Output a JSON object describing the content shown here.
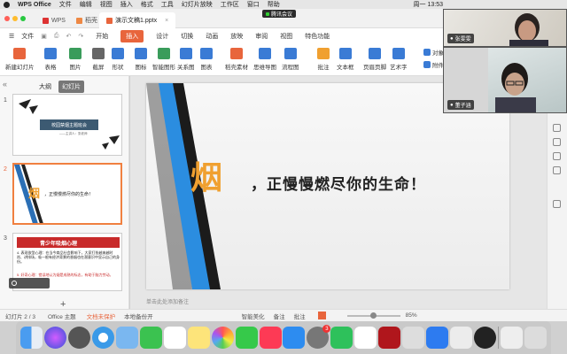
{
  "mac_menu": [
    "WPS Office",
    "文件",
    "编辑",
    "视图",
    "插入",
    "格式",
    "工具",
    "幻灯片放映",
    "工作区",
    "窗口",
    "帮助"
  ],
  "mac_status": {
    "clock": "周一 13:53"
  },
  "meeting_pill": "腾讯会议",
  "tabs": [
    {
      "label": "WPS",
      "active": false
    },
    {
      "label": "稻壳",
      "active": false
    },
    {
      "label": "演示文稿1.pptx",
      "active": true
    }
  ],
  "app_menu": {
    "left": [
      "文件"
    ],
    "tabs": [
      "开始",
      "插入",
      "设计",
      "切换",
      "动画",
      "放映",
      "审阅",
      "视图",
      "特色功能"
    ],
    "active_tab": "插入"
  },
  "ribbon": [
    {
      "label": "新建幻灯片",
      "color": "#e8653c"
    },
    {
      "label": "表格",
      "color": "#3a7bd5"
    },
    {
      "label": "图片",
      "color": "#3a9c5b"
    },
    {
      "label": "截屏",
      "color": "#666"
    },
    {
      "label": "形状",
      "color": "#3a7bd5"
    },
    {
      "label": "图标",
      "color": "#3a7bd5"
    },
    {
      "label": "智能图形",
      "color": "#3a9c5b"
    },
    {
      "label": "关系图",
      "color": "#3a7bd5"
    },
    {
      "label": "图表",
      "color": "#3a7bd5"
    },
    {
      "label": "稻壳素材",
      "color": "#e8653c"
    },
    {
      "label": "思维导图",
      "color": "#3a7bd5"
    },
    {
      "label": "流程图",
      "color": "#3a7bd5"
    },
    {
      "label": "批注",
      "color": "#f0a030"
    },
    {
      "label": "文本框",
      "color": "#3a7bd5"
    },
    {
      "label": "页眉页脚",
      "color": "#3a7bd5"
    },
    {
      "label": "艺术字",
      "color": "#3a7bd5"
    },
    {
      "label": "对象",
      "color": "#3a7bd5"
    },
    {
      "label": "附件",
      "color": "#3a7bd5"
    }
  ],
  "sidebar": {
    "tab_outline": "大纲",
    "tab_slides": "幻灯片"
  },
  "thumbs": [
    {
      "num": "1",
      "title": "校园禁烟主题班会",
      "subtitle": "——主讲人：张老师"
    },
    {
      "num": "2",
      "title": "，正慢慢燃尽你的生命！",
      "big": "烟"
    },
    {
      "num": "3",
      "title": "青少年吸烟心理",
      "body1": "4. 表现欲型心理：在当今商品社会影响下，大家打扮越来越时尚、讲排场，吸一根有经济背景的香烟也在潜意识中显示自己的身份。",
      "body2": "5. 好奇心理：错误地认为烟是成熟的标志，有助于脑力劳动。"
    }
  ],
  "slide": {
    "big": "烟",
    "line": "，正慢慢燃尽你的生命！"
  },
  "notes_placeholder": "单击此处添加备注",
  "videos": [
    {
      "name": "张雯雯"
    },
    {
      "name": "董子涵"
    }
  ],
  "status": {
    "slide": "幻灯片 2 / 3",
    "theme": "Office 主题",
    "protect": "文档未保护",
    "backup": "本地备份开",
    "smart": "智能美化",
    "notes": "备注",
    "comment": "批注",
    "zoom": "85%"
  },
  "dock_badge": "3"
}
